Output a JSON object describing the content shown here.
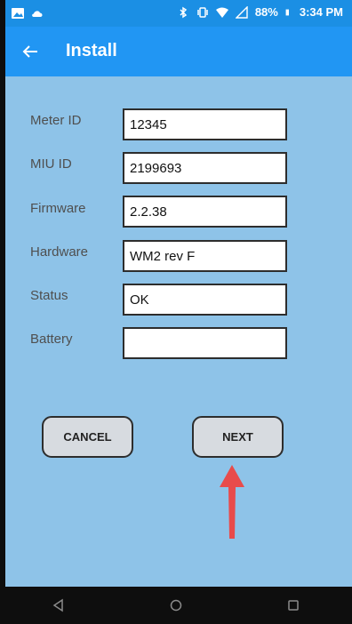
{
  "status_bar": {
    "battery_percent": "88%",
    "time": "3:34 PM"
  },
  "header": {
    "title": "Install"
  },
  "fields": [
    {
      "label": "Meter ID",
      "value": "12345"
    },
    {
      "label": "MIU ID",
      "value": "2199693"
    },
    {
      "label": "Firmware",
      "value": "2.2.38"
    },
    {
      "label": "Hardware",
      "value": "WM2 rev F"
    },
    {
      "label": "Status",
      "value": "OK"
    },
    {
      "label": "Battery",
      "value": ""
    }
  ],
  "buttons": {
    "cancel": "CANCEL",
    "next": "NEXT"
  },
  "colors": {
    "status_bar": "#1b8fe4",
    "app_bar": "#2196f3",
    "background": "#8ec3e8",
    "arrow": "#e84b4b"
  }
}
